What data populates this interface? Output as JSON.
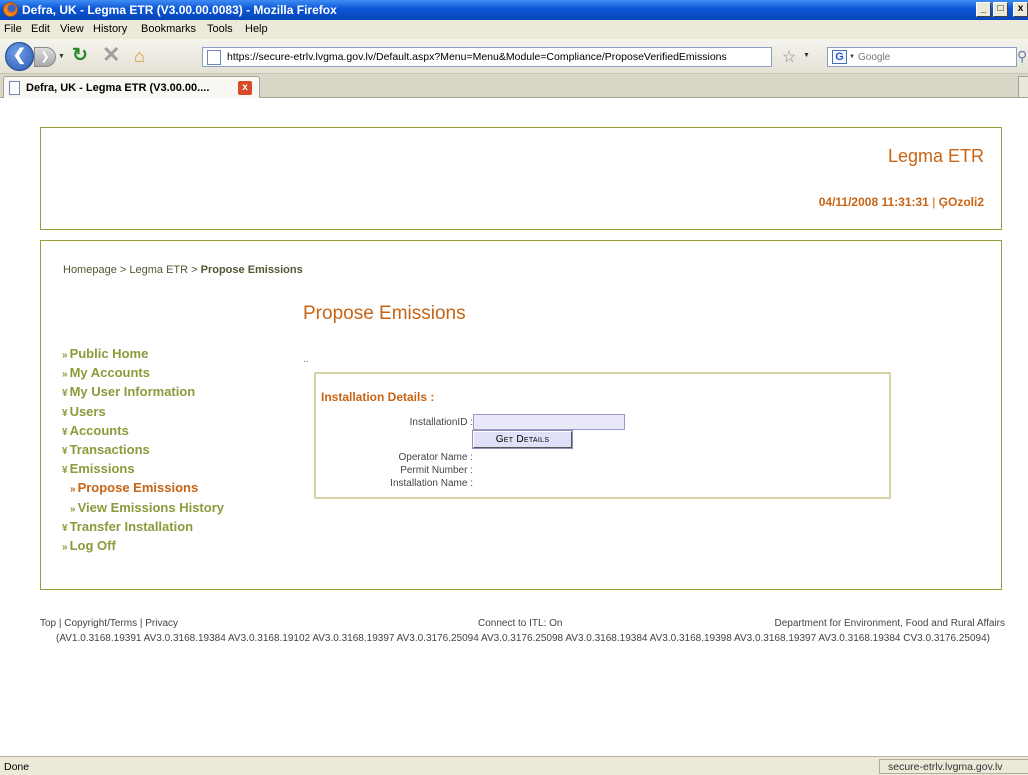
{
  "window": {
    "title": "Defra, UK - Legma ETR (V3.00.00.0083) - Mozilla Firefox",
    "controls": {
      "minimize": "_",
      "maximize": "□",
      "close": "x"
    }
  },
  "menu": {
    "items": [
      "File",
      "Edit",
      "View",
      "History",
      "Bookmarks",
      "Tools",
      "Help"
    ]
  },
  "toolbar": {
    "url": "https://secure-etrlv.lvgma.gov.lv/Default.aspx?Menu=Menu&Module=Compliance/ProposeVerifiedEmissions",
    "search_placeholder": "Google",
    "search_engine": "G"
  },
  "tab": {
    "label": "Defra, UK - Legma ETR (V3.00.00....",
    "close": "x"
  },
  "header": {
    "site_title": "Legma ETR",
    "datetime": "04/11/2008 11:31:31",
    "separator": "|",
    "username": "ĢOzoli2"
  },
  "breadcrumb": {
    "part1": "Homepage",
    "sep1": " > ",
    "part2": "Legma ETR",
    "sep2": " > ",
    "current": "Propose Emissions"
  },
  "page": {
    "title": "Propose Emissions",
    "dots": ".."
  },
  "nav": {
    "items": [
      {
        "label": "Public Home",
        "arrow": "»"
      },
      {
        "label": "My Accounts",
        "arrow": "»"
      },
      {
        "label": "My User Information",
        "arrow": "¥"
      },
      {
        "label": "Users",
        "arrow": "¥"
      },
      {
        "label": "Accounts",
        "arrow": "¥"
      },
      {
        "label": "Transactions",
        "arrow": "¥"
      },
      {
        "label": "Emissions",
        "arrow": "¥"
      },
      {
        "label": "Propose Emissions",
        "arrow": "»"
      },
      {
        "label": "View Emissions History",
        "arrow": "»"
      },
      {
        "label": "Transfer Installation",
        "arrow": "¥"
      },
      {
        "label": "Log Off",
        "arrow": "»"
      }
    ]
  },
  "installation": {
    "title": "Installation Details :",
    "id_label": "InstallationID :",
    "id_value": "",
    "button": "Get Details",
    "operator_label": "Operator Name :",
    "permit_label": "Permit Number :",
    "name_label": "Installation Name :"
  },
  "footer": {
    "links": "Top | Copyright/Terms | Privacy",
    "itl_status": "Connect to ITL: On",
    "department": "Department for Environment, Food and Rural Affairs",
    "versions": "(AV1.0.3168.19391 AV3.0.3168.19384 AV3.0.3168.19102 AV3.0.3168.19397 AV3.0.3176.25094 AV3.0.3176.25098 AV3.0.3168.19384 AV3.0.3168.19398 AV3.0.3168.19397 AV3.0.3168.19384 CV3.0.3176.25094)"
  },
  "status": {
    "text": "Done",
    "host": "secure-etrlv.lvgma.gov.lv"
  }
}
